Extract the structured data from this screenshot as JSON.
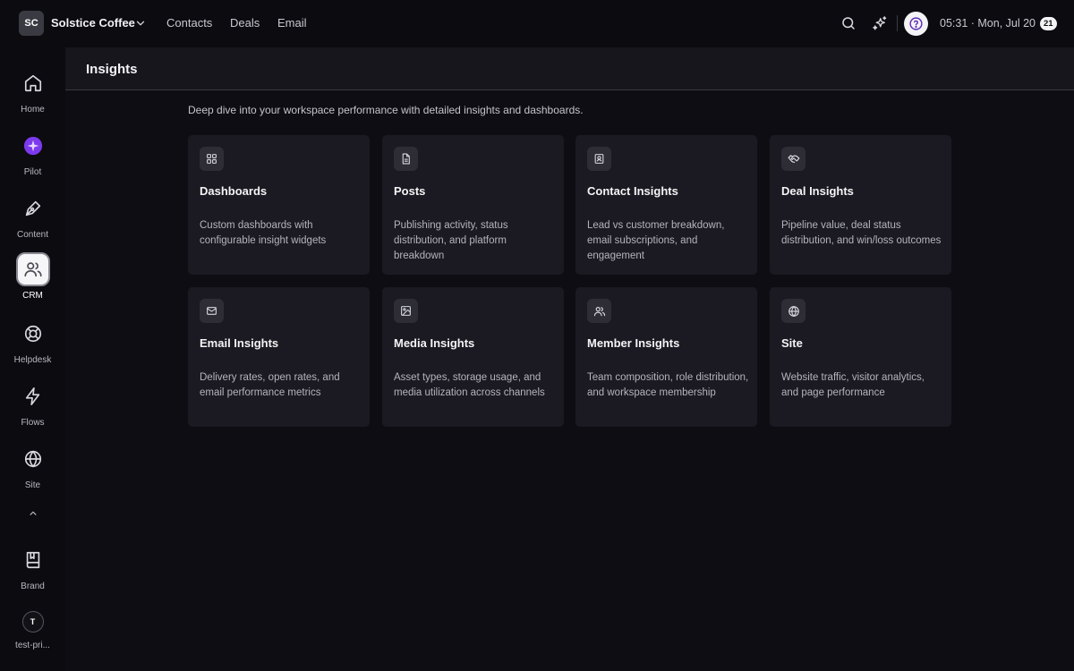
{
  "workspace": {
    "initials": "SC",
    "name": "Solstice Coffee"
  },
  "topnav": [
    {
      "label": "Contacts"
    },
    {
      "label": "Deals"
    },
    {
      "label": "Email"
    }
  ],
  "status": {
    "time": "05:31 · Mon, Jul 20",
    "badge": "21"
  },
  "sidebar": {
    "items": [
      {
        "label": "Home",
        "icon": "home-icon"
      },
      {
        "label": "Pilot",
        "icon": "pilot-icon"
      },
      {
        "label": "Content",
        "icon": "pen-icon"
      },
      {
        "label": "CRM",
        "icon": "users-icon",
        "active": true
      },
      {
        "label": "Helpdesk",
        "icon": "lifebuoy-icon"
      },
      {
        "label": "Flows",
        "icon": "bolt-icon"
      },
      {
        "label": "Site",
        "icon": "globe-icon"
      }
    ],
    "brand": {
      "label": "Brand",
      "icon": "book-icon"
    },
    "user": {
      "initial": "T",
      "label": "test-pri..."
    }
  },
  "page": {
    "title": "Insights",
    "intro": "Deep dive into your workspace performance with detailed insights and dashboards."
  },
  "cards": [
    {
      "title": "Dashboards",
      "desc": "Custom dashboards with configurable insight widgets",
      "icon": "grid-icon"
    },
    {
      "title": "Posts",
      "desc": "Publishing activity, status distribution, and platform breakdown",
      "icon": "document-icon"
    },
    {
      "title": "Contact Insights",
      "desc": "Lead vs customer breakdown, email subscriptions, and engagement",
      "icon": "contact-card-icon"
    },
    {
      "title": "Deal Insights",
      "desc": "Pipeline value, deal status distribution, and win/loss outcomes",
      "icon": "handshake-icon"
    },
    {
      "title": "Email Insights",
      "desc": "Delivery rates, open rates, and email performance metrics",
      "icon": "mail-icon"
    },
    {
      "title": "Media Insights",
      "desc": "Asset types, storage usage, and media utilization across channels",
      "icon": "image-icon"
    },
    {
      "title": "Member Insights",
      "desc": "Team composition, role distribution, and workspace membership",
      "icon": "users-icon"
    },
    {
      "title": "Site",
      "desc": "Website traffic, visitor analytics, and page performance",
      "icon": "globe-icon"
    }
  ],
  "colors": {
    "background": "#0c0b10",
    "card": "#1b1a22",
    "accent": "#7c3aed"
  }
}
